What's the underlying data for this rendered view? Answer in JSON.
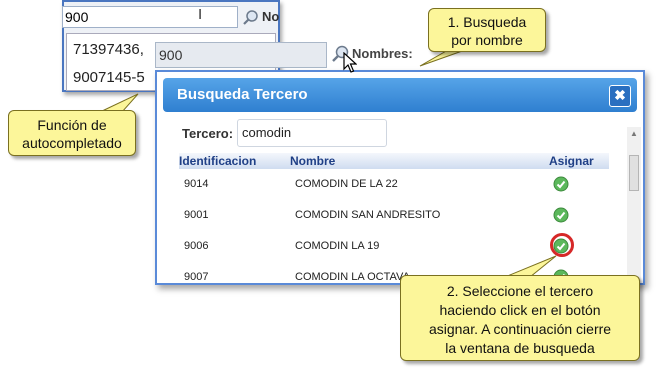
{
  "back_panel": {
    "search_value": "900",
    "name_label_partial": "No",
    "suggestions": [
      "71397436,",
      "9007145-5"
    ]
  },
  "mid_panel": {
    "search_value": "900",
    "name_label": "Nombres:"
  },
  "dialog": {
    "title": "Busqueda Tercero",
    "close_glyph": "✖",
    "filter_label": "Tercero:",
    "filter_value": "comodin",
    "columns": {
      "id": "Identificacion",
      "name": "Nombre",
      "assign": "Asignar"
    },
    "rows": [
      {
        "id": "9014",
        "name": "COMODIN DE LA 22"
      },
      {
        "id": "9001",
        "name": "COMODIN SAN ANDRESITO"
      },
      {
        "id": "9006",
        "name": "COMODIN LA 19"
      },
      {
        "id": "9007",
        "name": "COMODIN LA OCTAVA"
      }
    ],
    "assign_icon": "check-circle-icon"
  },
  "callouts": {
    "busqueda": [
      "1. Busqueda",
      "por nombre"
    ],
    "autocompletado": [
      "Función de",
      "autocompletado"
    ],
    "seleccione": [
      "2. Seleccione el tercero",
      "haciendo click en el botón",
      "asignar. A continuación cierre",
      "la ventana de busqueda"
    ]
  },
  "colors": {
    "dialog_title": "#2f7fd0",
    "callout_bg": "#fcf69a",
    "highlight_ring": "#d62828",
    "assign_check": "#4caf50"
  }
}
